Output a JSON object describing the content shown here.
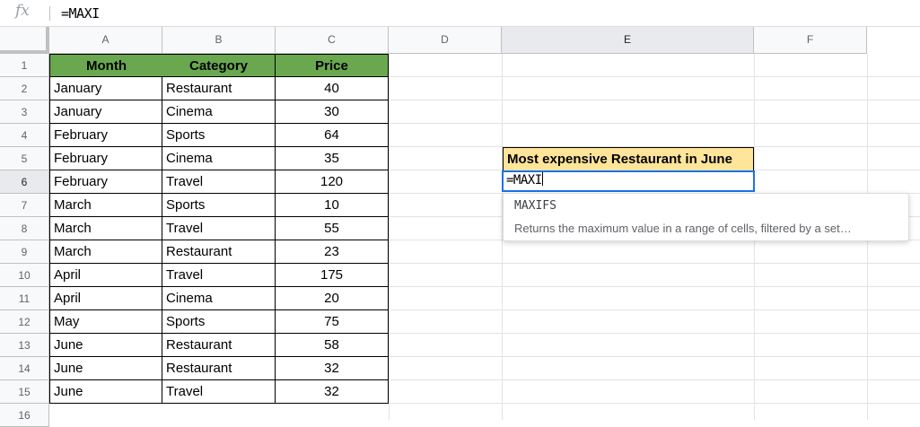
{
  "formula_bar": {
    "fx_label": "fx",
    "value": "=MAXI"
  },
  "columns": [
    "A",
    "B",
    "C",
    "D",
    "E",
    "F"
  ],
  "rows": [
    "1",
    "2",
    "3",
    "4",
    "5",
    "6",
    "7",
    "8",
    "9",
    "10",
    "11",
    "12",
    "13",
    "14",
    "15",
    "16"
  ],
  "table": {
    "headers": [
      "Month",
      "Category",
      "Price"
    ],
    "rows": [
      [
        "January",
        "Restaurant",
        "40"
      ],
      [
        "January",
        "Cinema",
        "30"
      ],
      [
        "February",
        "Sports",
        "64"
      ],
      [
        "February",
        "Cinema",
        "35"
      ],
      [
        "February",
        "Travel",
        "120"
      ],
      [
        "March",
        "Sports",
        "10"
      ],
      [
        "March",
        "Travel",
        "55"
      ],
      [
        "March",
        "Restaurant",
        "23"
      ],
      [
        "April",
        "Travel",
        "175"
      ],
      [
        "April",
        "Cinema",
        "20"
      ],
      [
        "May",
        "Sports",
        "75"
      ],
      [
        "June",
        "Restaurant",
        "58"
      ],
      [
        "June",
        "Restaurant",
        "32"
      ],
      [
        "June",
        "Travel",
        "32"
      ]
    ]
  },
  "e5_label": "Most expensive Restaurant in June",
  "e6_editing": "=MAXI",
  "autocomplete": {
    "function_name": "MAXIFS",
    "description": "Returns the maximum value in a range of cells, filtered by a set…"
  },
  "colors": {
    "header_green": "#6aa84f",
    "label_yellow": "#ffe599",
    "active_blue": "#1a73e8"
  }
}
